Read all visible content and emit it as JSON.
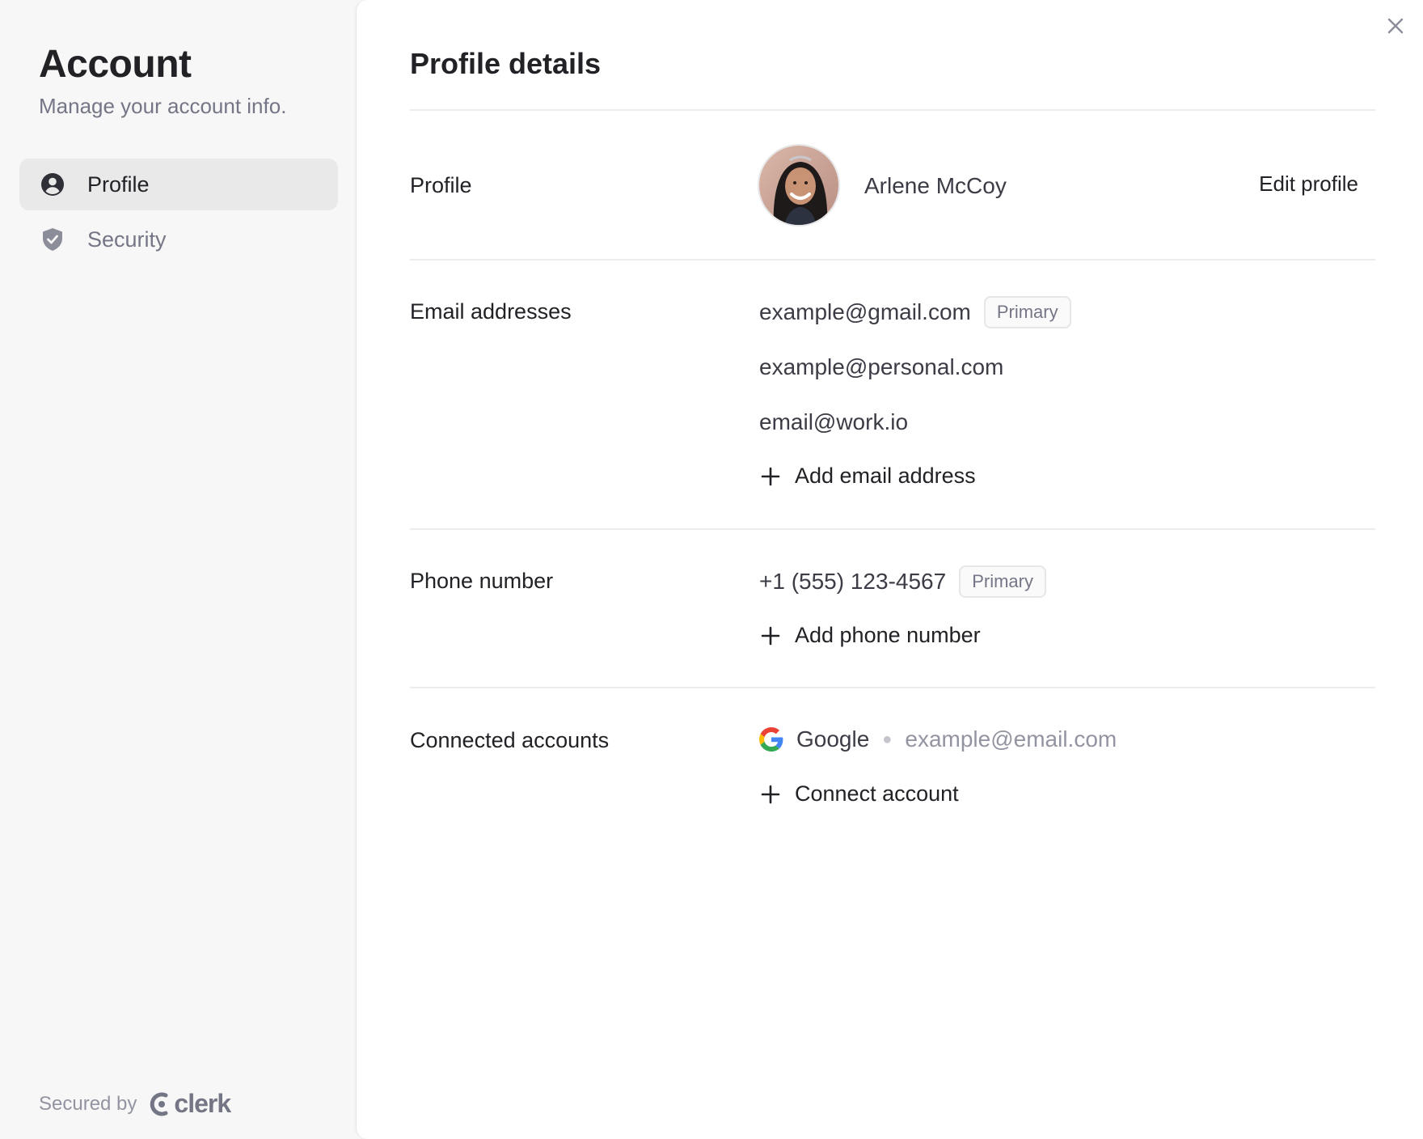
{
  "sidebar": {
    "title": "Account",
    "subtitle": "Manage your account info.",
    "items": [
      {
        "label": "Profile",
        "icon": "user-circle-icon",
        "active": true
      },
      {
        "label": "Security",
        "icon": "shield-check-icon",
        "active": false
      }
    ],
    "secured_by": "Secured by",
    "brand": "clerk"
  },
  "panel": {
    "title": "Profile details",
    "profile": {
      "label": "Profile",
      "name": "Arlene McCoy",
      "edit_label": "Edit profile"
    },
    "emails": {
      "label": "Email addresses",
      "items": [
        {
          "address": "example@gmail.com",
          "badge": "Primary"
        },
        {
          "address": "example@personal.com"
        },
        {
          "address": "email@work.io"
        }
      ],
      "add_label": "Add email address"
    },
    "phones": {
      "label": "Phone number",
      "items": [
        {
          "number": "+1 (555) 123-4567",
          "badge": "Primary"
        }
      ],
      "add_label": "Add phone number"
    },
    "connected": {
      "label": "Connected accounts",
      "items": [
        {
          "provider": "Google",
          "email": "example@email.com"
        }
      ],
      "add_label": "Connect account"
    }
  },
  "colors": {
    "sidebar_bg": "#f7f7f7",
    "active_item_bg": "#e9e9e9",
    "text_primary": "#212126",
    "text_muted": "#747686"
  }
}
